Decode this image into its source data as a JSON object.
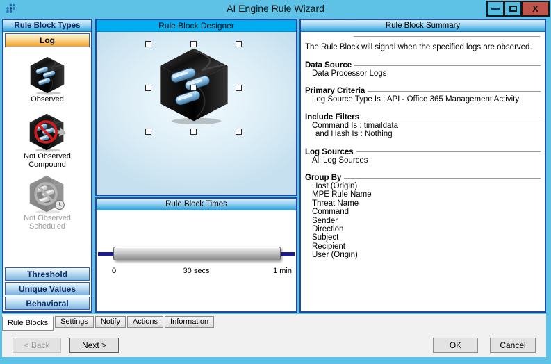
{
  "window": {
    "title": "AI Engine Rule Wizard",
    "close_label": "X"
  },
  "left_panel": {
    "header": "Rule Block Types",
    "log_button": "Log",
    "types": [
      {
        "line1": "Observed",
        "line2": ""
      },
      {
        "line1": "Not Observed",
        "line2": "Compound"
      },
      {
        "line1": "Not Observed",
        "line2": "Scheduled"
      }
    ],
    "category_buttons": [
      "Threshold",
      "Unique Values",
      "Behavioral"
    ]
  },
  "designer": {
    "header": "Rule Block Designer"
  },
  "times": {
    "header": "Rule Block Times",
    "ticks": {
      "start": "0",
      "mid": "30 secs",
      "end": "1 min"
    }
  },
  "summary": {
    "header": "Rule Block Summary",
    "intro": "The Rule Block will signal when the specified logs are observed.",
    "sections": [
      {
        "title": "Data Source",
        "lines": [
          "Data Processor Logs"
        ]
      },
      {
        "title": "Primary Criteria",
        "lines": [
          "Log Source Type Is : API - Office 365 Management Activity"
        ]
      },
      {
        "title": "Include Filters",
        "lines": [
          "Command Is : timaildata",
          "and Hash Is :  Nothing"
        ]
      },
      {
        "title": "Log Sources",
        "lines": [
          "All Log Sources"
        ]
      },
      {
        "title": "Group By",
        "lines": [
          "Host (Origin)",
          "MPE Rule Name",
          "Threat Name",
          "Command",
          "Sender",
          "Direction",
          "Subject",
          "Recipient",
          "User (Origin)"
        ]
      }
    ]
  },
  "tabs": [
    "Rule Blocks",
    "Settings",
    "Notify",
    "Actions",
    "Information"
  ],
  "footer": {
    "back": "< Back",
    "next": "Next >",
    "ok": "OK",
    "cancel": "Cancel"
  },
  "colors": {
    "frame_blue": "#5EC1E6",
    "designer_cyan": "#00AEEF",
    "header_blue": "#2EA3DC",
    "accent_orange": "#F5A01D",
    "close_red": "#BF544B",
    "slider_navy": "#1C1C96"
  }
}
